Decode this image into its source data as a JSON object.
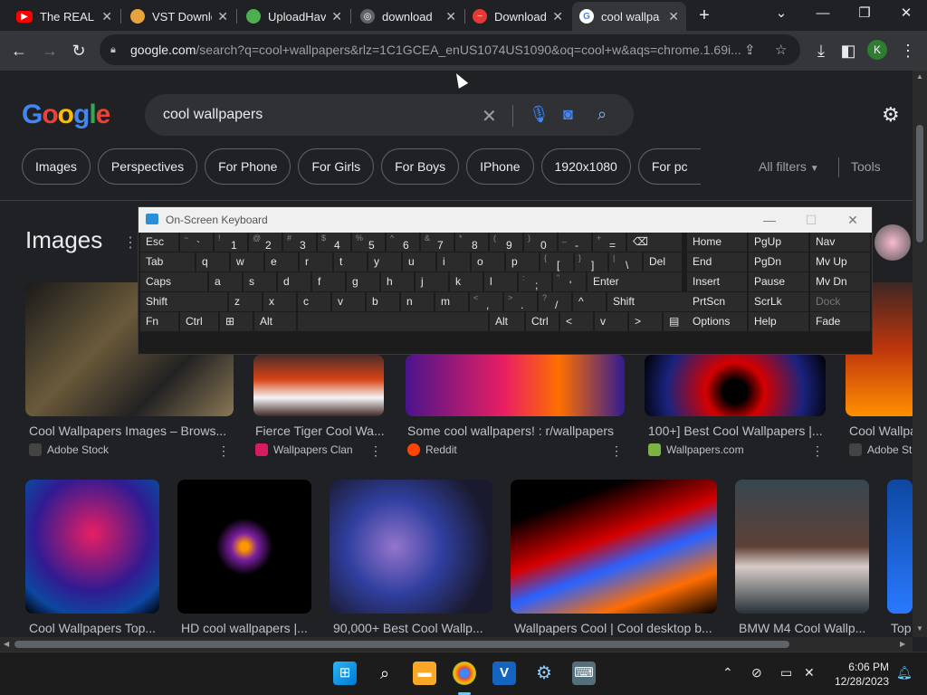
{
  "browser": {
    "tabs": [
      {
        "label": "The REAL P",
        "icon": "youtube-icon",
        "color": "#ff0000"
      },
      {
        "label": "VST Downlo",
        "icon": "vst-icon",
        "color": "#e8a33d"
      },
      {
        "label": "UploadHav",
        "icon": "cloud-icon",
        "color": "#4caf50"
      },
      {
        "label": "download",
        "icon": "globe-icon",
        "color": "#9aa0a6"
      },
      {
        "label": "Download",
        "icon": "stop-icon",
        "color": "#e53935"
      },
      {
        "label": "cool wallpa",
        "icon": "google-icon",
        "color": "#4285f4"
      }
    ],
    "url_domain": "google.com",
    "url_rest": "/search?q=cool+wallpapers&rlz=1C1GCEA_enUS1074US1090&oq=cool+w&aqs=chrome.1.69i...",
    "profile_initial": "K"
  },
  "google": {
    "logo": "Google",
    "query": "cool wallpapers",
    "chips": [
      "Images",
      "Perspectives",
      "For Phone",
      "For Girls",
      "For Boys",
      "IPhone",
      "1920x1080",
      "For pc"
    ],
    "all_filters": "All filters",
    "tools": "Tools",
    "images_heading": "Images"
  },
  "results_row1": [
    {
      "caption": "Cool Wallpapers Images – Brows...",
      "source": "Adobe Stock",
      "fav": "#444444"
    },
    {
      "caption": "Fierce Tiger Cool Wa...",
      "source": "Wallpapers Clan",
      "fav": "#d81b60"
    },
    {
      "caption": "Some cool wallpapers! : r/wallpapers",
      "source": "Reddit",
      "fav": "#ff4500"
    },
    {
      "caption": "100+] Best Cool Wallpapers |...",
      "source": "Wallpapers.com",
      "fav": "#7cb342"
    },
    {
      "caption": "Cool Wallpa",
      "source": "Adobe St",
      "fav": "#444444"
    }
  ],
  "results_row2": [
    {
      "caption": "Cool Wallpapers Top..."
    },
    {
      "caption": "HD cool wallpapers |..."
    },
    {
      "caption": "90,000+ Best Cool Wallp..."
    },
    {
      "caption": "Wallpapers Cool | Cool desktop b..."
    },
    {
      "caption": "BMW M4 Cool Wallp..."
    },
    {
      "caption": "Top"
    }
  ],
  "osk": {
    "title": "On-Screen Keyboard",
    "row1": [
      {
        "main": "Esc"
      },
      {
        "top": "~",
        "main": "`"
      },
      {
        "top": "!",
        "main": "1"
      },
      {
        "top": "@",
        "main": "2"
      },
      {
        "top": "#",
        "main": "3"
      },
      {
        "top": "$",
        "main": "4"
      },
      {
        "top": "%",
        "main": "5"
      },
      {
        "top": "^",
        "main": "6"
      },
      {
        "top": "&",
        "main": "7"
      },
      {
        "top": "*",
        "main": "8"
      },
      {
        "top": "(",
        "main": "9"
      },
      {
        "top": ")",
        "main": "0"
      },
      {
        "top": "_",
        "main": "-"
      },
      {
        "top": "+",
        "main": "="
      },
      {
        "main": "⌫"
      }
    ],
    "row2": [
      {
        "main": "Tab"
      },
      {
        "main": "q"
      },
      {
        "main": "w"
      },
      {
        "main": "e"
      },
      {
        "main": "r"
      },
      {
        "main": "t"
      },
      {
        "main": "y"
      },
      {
        "main": "u"
      },
      {
        "main": "i"
      },
      {
        "main": "o"
      },
      {
        "main": "p"
      },
      {
        "top": "{",
        "main": "["
      },
      {
        "top": "}",
        "main": "]"
      },
      {
        "top": "|",
        "main": "\\"
      },
      {
        "main": "Del"
      }
    ],
    "row3": [
      {
        "main": "Caps"
      },
      {
        "main": "a"
      },
      {
        "main": "s"
      },
      {
        "main": "d"
      },
      {
        "main": "f"
      },
      {
        "main": "g"
      },
      {
        "main": "h"
      },
      {
        "main": "j"
      },
      {
        "main": "k"
      },
      {
        "main": "l"
      },
      {
        "top": ":",
        "main": ";"
      },
      {
        "top": "\"",
        "main": "'"
      },
      {
        "main": "Enter"
      }
    ],
    "row4": [
      {
        "main": "Shift"
      },
      {
        "main": "z"
      },
      {
        "main": "x"
      },
      {
        "main": "c"
      },
      {
        "main": "v"
      },
      {
        "main": "b"
      },
      {
        "main": "n"
      },
      {
        "main": "m"
      },
      {
        "top": "<",
        "main": ","
      },
      {
        "top": ">",
        "main": "."
      },
      {
        "top": "?",
        "main": "/"
      },
      {
        "main": "^"
      },
      {
        "main": "Shift"
      }
    ],
    "row5": [
      {
        "main": "Fn"
      },
      {
        "main": "Ctrl"
      },
      {
        "main": "⊞"
      },
      {
        "main": "Alt"
      },
      {
        "main": ""
      },
      {
        "main": "Alt"
      },
      {
        "main": "Ctrl"
      },
      {
        "main": "<"
      },
      {
        "main": "v"
      },
      {
        "main": ">"
      },
      {
        "main": "▤"
      }
    ],
    "nav": [
      [
        "Home",
        "PgUp",
        "Nav"
      ],
      [
        "End",
        "PgDn",
        "Mv Up"
      ],
      [
        "Insert",
        "Pause",
        "Mv Dn"
      ],
      [
        "PrtScn",
        "ScrLk",
        "Dock"
      ],
      [
        "Options",
        "Help",
        "Fade"
      ]
    ]
  },
  "taskbar": {
    "time": "6:06 PM",
    "date": "12/28/2023"
  }
}
